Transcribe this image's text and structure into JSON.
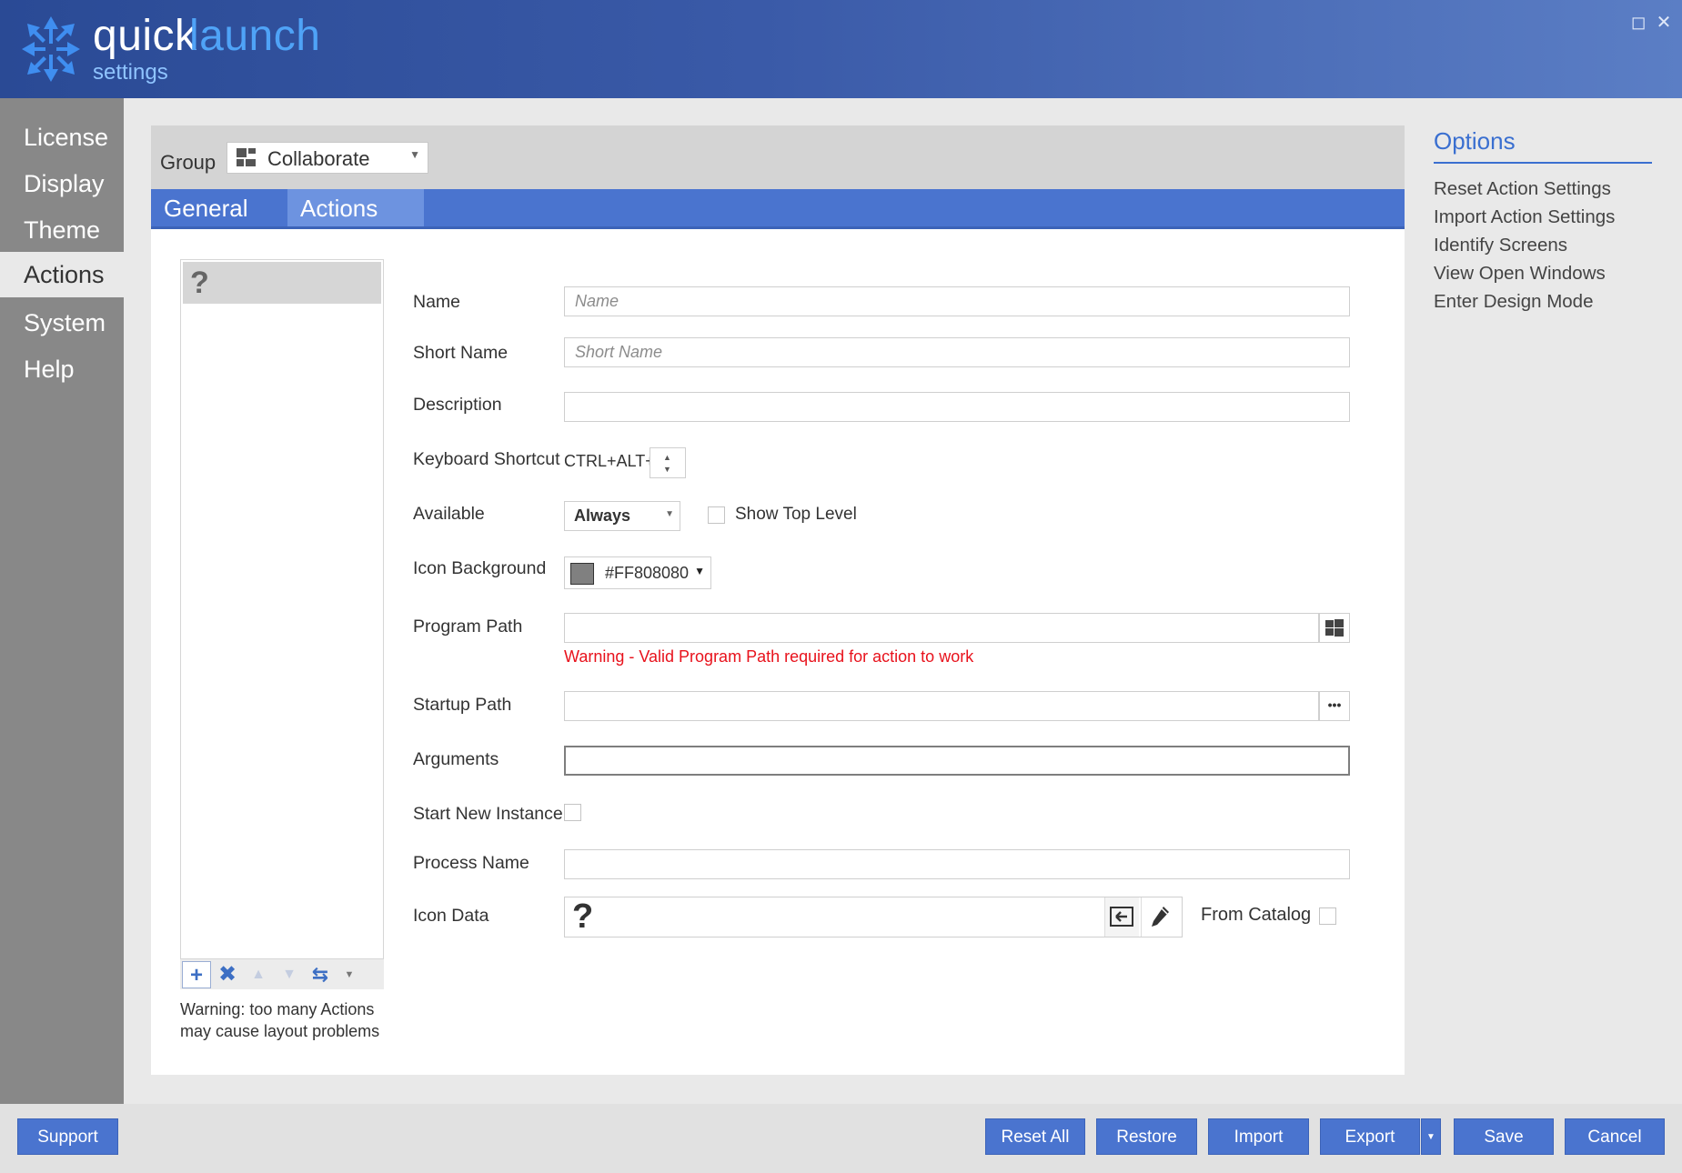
{
  "app": {
    "brand_quick": "quick",
    "brand_launch": "launch",
    "brand_sub": "settings",
    "maximize_glyph": "◻",
    "close_glyph": "✕"
  },
  "nav": {
    "items": [
      {
        "label": "License"
      },
      {
        "label": "Display"
      },
      {
        "label": "Theme"
      },
      {
        "label": "Actions"
      },
      {
        "label": "System"
      },
      {
        "label": "Help"
      }
    ],
    "active": "Actions"
  },
  "group": {
    "label": "Group",
    "value": "Collaborate"
  },
  "tabs": [
    {
      "label": "General"
    },
    {
      "label": "Actions"
    }
  ],
  "action_list": {
    "item_icon": "?",
    "toolbar": {
      "add": "+",
      "delete": "✖",
      "up": "▲",
      "down": "▼",
      "swap": "⇆",
      "more": "▼"
    },
    "warning_line1": "Warning: too many Actions",
    "warning_line2": "may cause layout problems"
  },
  "form": {
    "name_label": "Name",
    "name_placeholder": "Name",
    "short_name_label": "Short Name",
    "short_name_placeholder": "Short Name",
    "description_label": "Description",
    "keyboard_label": "Keyboard Shortcut",
    "keyboard_prefix": "CTRL+ALT+",
    "available_label": "Available",
    "available_value": "Always",
    "show_top_level_label": "Show Top Level",
    "icon_bg_label": "Icon Background",
    "icon_bg_value": "#FF808080",
    "icon_bg_color": "#808080",
    "program_path_label": "Program Path",
    "program_path_warning": "Warning - Valid Program Path required for action to work",
    "startup_path_label": "Startup Path",
    "browse_glyph": "•••",
    "arguments_label": "Arguments",
    "start_new_instance_label": "Start New Instance",
    "process_name_label": "Process Name",
    "icon_data_label": "Icon Data",
    "icon_data_value": "?",
    "from_catalog_label": "From Catalog"
  },
  "options": {
    "title": "Options",
    "links": [
      {
        "label": "Reset Action Settings"
      },
      {
        "label": "Import Action Settings"
      },
      {
        "label": "Identify Screens"
      },
      {
        "label": "View Open Windows"
      },
      {
        "label": "Enter Design Mode"
      }
    ]
  },
  "footer": {
    "support": "Support",
    "reset_all": "Reset All",
    "restore": "Restore",
    "import": "Import",
    "export": "Export",
    "export_caret": "▼",
    "save": "Save",
    "cancel": "Cancel"
  },
  "colors": {
    "accent": "#4a74cf",
    "header_start": "#2a4a95",
    "header_end": "#5b7ec5",
    "nav_bg": "#888888",
    "warning": "#e8121c",
    "options_title": "#3a6fd0"
  }
}
